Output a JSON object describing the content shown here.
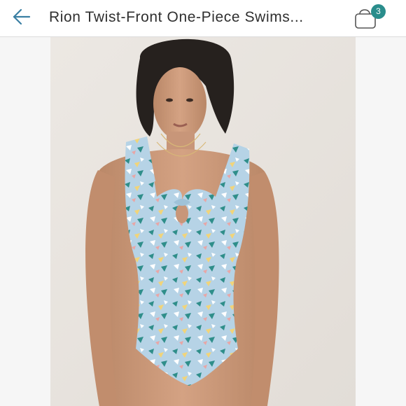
{
  "header": {
    "title": "Rion Twist-Front One-Piece Swims...",
    "back_icon": "arrow-left-icon",
    "bag_icon": "shopping-bag-icon",
    "bag_count": "3"
  },
  "colors": {
    "accent": "#2a8d8c",
    "back_arrow": "#3a7fa3",
    "swimsuit_base": "#b6d3e6"
  },
  "product_image": {
    "subject": "model-wearing-swimsuit"
  }
}
